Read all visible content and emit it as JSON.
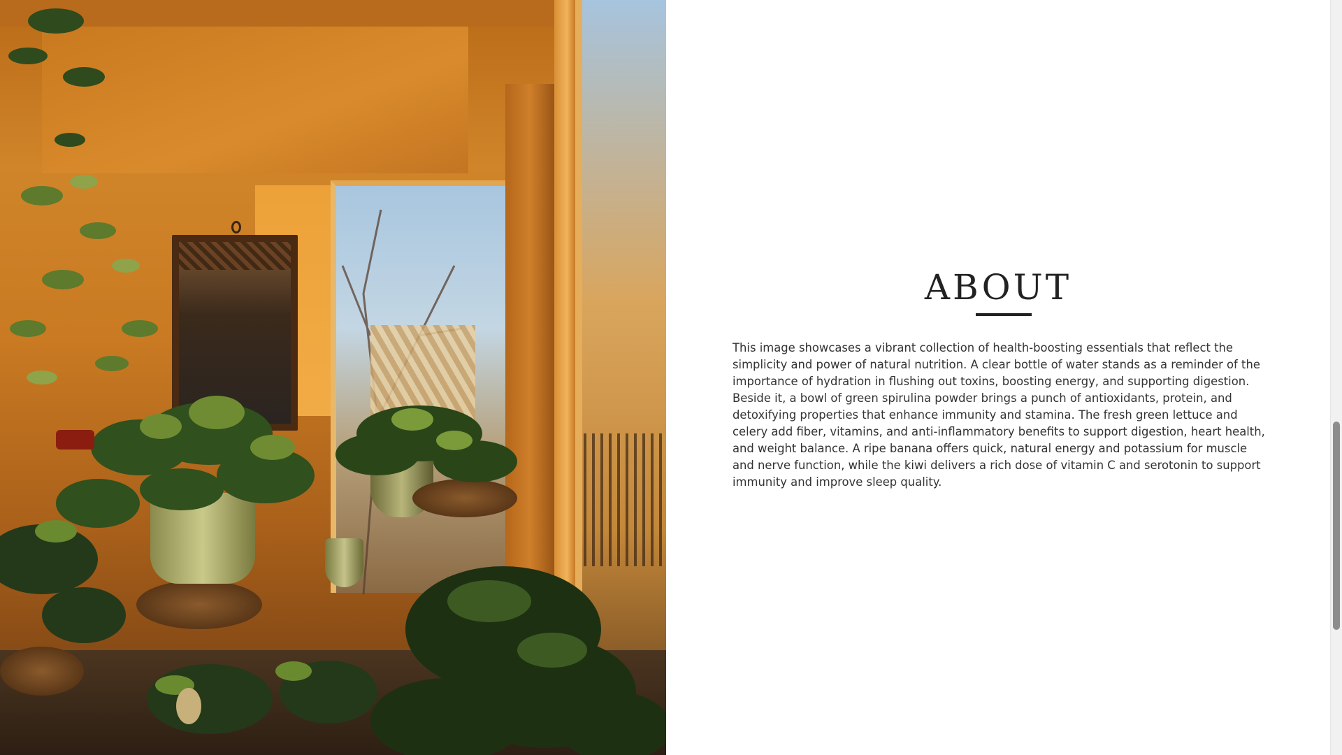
{
  "about": {
    "title": "ABOUT",
    "body": "This image showcases a vibrant collection of health-boosting essentials that reflect the simplicity and power of natural nutrition. A clear bottle of water stands as a reminder of the importance of hydration in flushing out toxins, boosting energy, and supporting digestion. Beside it, a bowl of green spirulina powder brings a punch of antioxidants, protein, and detoxifying properties that enhance immunity and stamina. The fresh green lettuce and celery add fiber, vitamins, and anti-inflammatory benefits to support digestion, heart health, and weight balance. A ripe banana offers quick, natural energy and potassium for muscle and nerve function, while the kiwi delivers a rich dose of vitamin C and serotonin to support immunity and improve sleep quality."
  },
  "colors": {
    "title": "#222222",
    "body_text": "#333333",
    "background": "#ffffff",
    "scrollbar_thumb": "#8d8d8d"
  },
  "image": {
    "subject": "sunlit-room-with-houseplants"
  }
}
